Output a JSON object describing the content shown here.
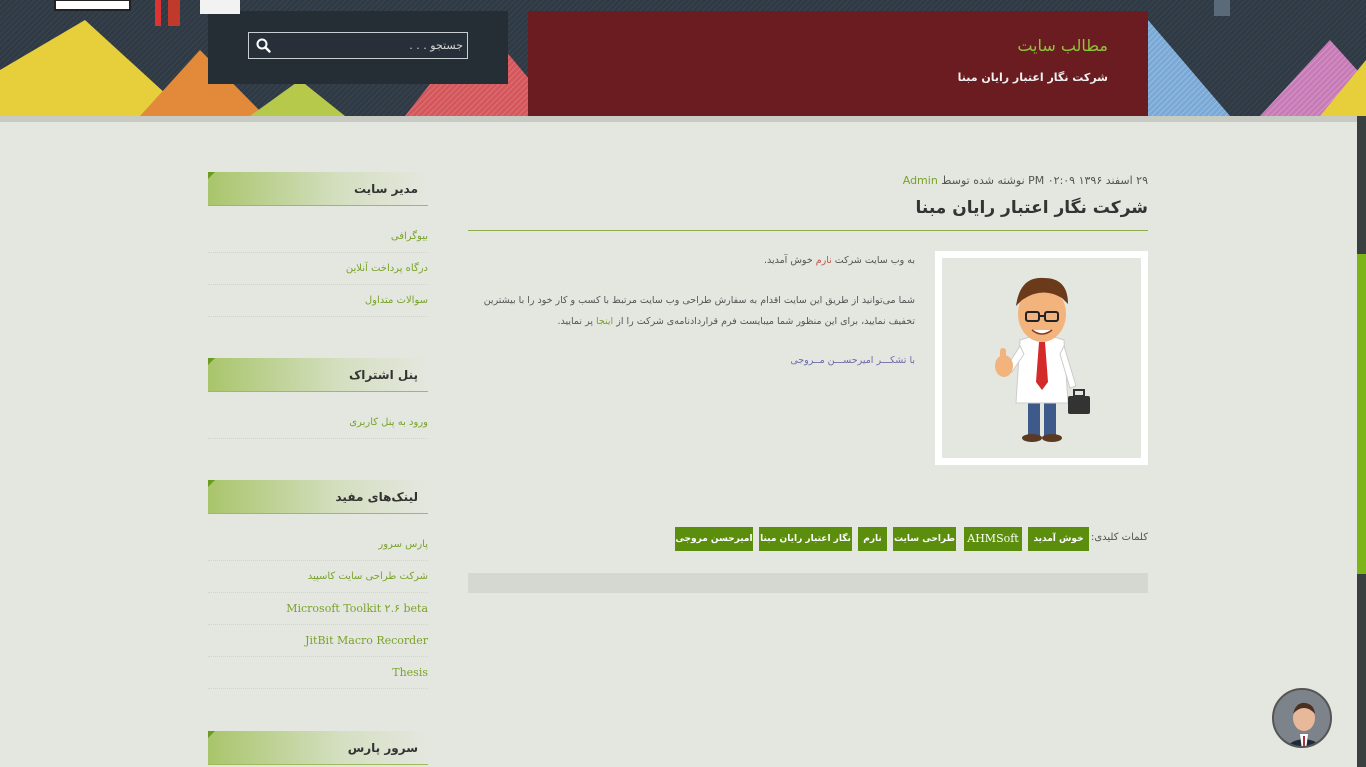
{
  "header": {
    "site_title": "مطالب سایت",
    "site_description": "شرکت نگار اعتبار رایان مبنا",
    "search_placeholder": "جستجو . . ."
  },
  "sidebar": {
    "widgets": [
      {
        "title": "مدیر سایت",
        "links": [
          "بیوگرافی",
          "درگاه پرداخت آنلاین",
          "سوالات متداول"
        ]
      },
      {
        "title": "پنل اشتراک",
        "links": [
          "ورود به پنل کاربری"
        ]
      },
      {
        "title": "لینک‌های مفید",
        "links": [
          "پارس سرور",
          "شرکت طراحی سایت کاسپید",
          "Microsoft Toolkit ۲.۶ beta",
          "JitBit Macro Recorder",
          "Thesis"
        ]
      },
      {
        "title": "سرور پارس"
      }
    ]
  },
  "post": {
    "meta_date": "۲۹ اسفند ۱۳۹۶ ۰۲:۰۹ PM نوشته شده توسط",
    "meta_author": "Admin",
    "title": "شرکت نگار اعتبار رایان مبنا",
    "intro_prefix": "به وب سایت شرکت",
    "intro_brand": "نارم",
    "intro_suffix": "خوش آمدید.",
    "body_line1": "شما می‌توانید از طریق این سایت اقدام به سفارش طراحی وب سایت مرتبط با کسب و کار خود را با بیشترین",
    "body_line2_prefix": "تخفیف نمایید، برای این منظور شما میبایست فرم قراردادنامه‌ی شرکت را از",
    "body_line2_link": "اینجا",
    "body_line2_suffix": "پر نمایید.",
    "signature": "با تشکـــر امیرحســـن مــروجی"
  },
  "tags": {
    "label": "کلمات کلیدی:",
    "items": [
      "خوش آمدید",
      "AHMSoft",
      "طراحی سایت",
      "نارم",
      "نگار اعتبار رایان مبنا",
      "امیرحسن مروجی"
    ]
  },
  "colors": {
    "accent": "#7aa22b",
    "tag_bg": "#5a8e0c",
    "scroll_thumb": "#7cb518"
  }
}
